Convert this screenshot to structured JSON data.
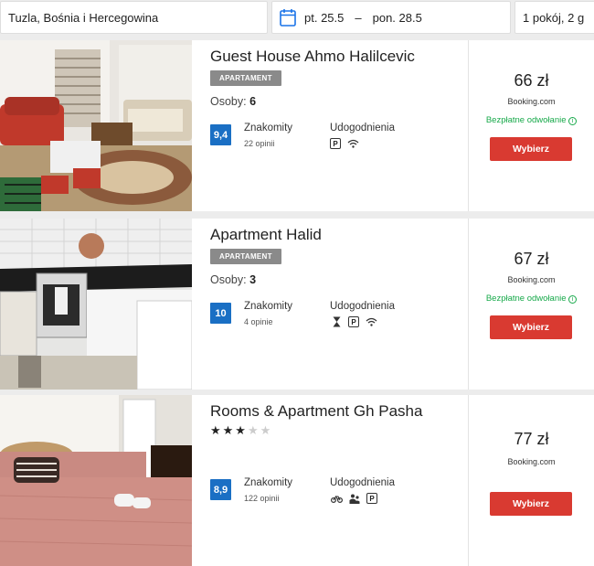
{
  "search": {
    "location": "Tuzla, Bośnia i Hercegowina",
    "checkin": "pt. 25.5",
    "separator": "–",
    "checkout": "pon. 28.5",
    "guests": "1 pokój, 2 g"
  },
  "results": [
    {
      "name": "Guest House Ahmo Halilcevic",
      "type": "APARTAMENT",
      "persons_label": "Osoby: ",
      "persons": "6",
      "score": "9,4",
      "score_label": "Znakomity",
      "reviews": "22 opinii",
      "amenities_label": "Udogodnienia",
      "amenities": [
        "parking-icon",
        "wifi-icon"
      ],
      "price": "66 zł",
      "provider": "Booking.com",
      "cancel": "Bezpłatne odwołanie",
      "button": "Wybierz"
    },
    {
      "name": "Apartment Halid",
      "type": "APARTAMENT",
      "persons_label": "Osoby: ",
      "persons": "3",
      "score": "10",
      "score_label": "Znakomity",
      "reviews": "4 opinie",
      "amenities_label": "Udogodnienia",
      "amenities": [
        "hourglass-icon",
        "parking-icon",
        "wifi-icon"
      ],
      "price": "67 zł",
      "provider": "Booking.com",
      "cancel": "Bezpłatne odwołanie",
      "button": "Wybierz"
    },
    {
      "name": "Rooms & Apartment Gh Pasha",
      "stars": 3,
      "stars_max": 5,
      "score": "8,9",
      "score_label": "Znakomity",
      "reviews": "122 opinii",
      "amenities_label": "Udogodnienia",
      "amenities": [
        "bicycle-icon",
        "family-icon",
        "parking-icon"
      ],
      "price": "77 zł",
      "provider": "Booking.com",
      "button": "Wybierz"
    }
  ],
  "colors": {
    "score_badge": "#1a6fc4",
    "button": "#d93a31",
    "cancel_text": "#17a94a",
    "type_badge": "#8a8a8a"
  }
}
